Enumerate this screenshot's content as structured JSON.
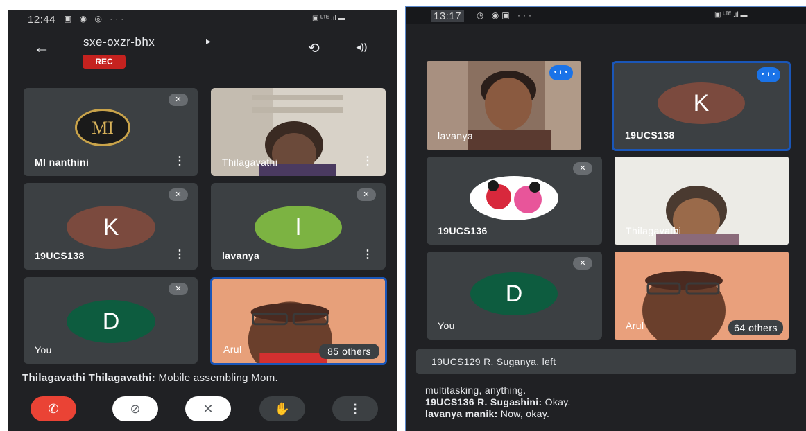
{
  "left": {
    "status": {
      "time": "12:44",
      "icons": "▣ ◉ ◎ ···",
      "right": "▣ ᴸᵀᴱ .ıl ▬"
    },
    "meeting": {
      "code": "sxe-oxzr-bhx",
      "code_arrow": "▸",
      "rec_label": "REC"
    },
    "back_icon": "←",
    "switch_camera_icon": "⟲",
    "speaker_icon": "◂))",
    "tiles": [
      {
        "name": "MI nanthini",
        "avatar_text": "MI",
        "menu": "⋮"
      },
      {
        "name": "Thilagavathi",
        "menu": "⋮"
      },
      {
        "name": "19UCS138",
        "avatar_text": "K",
        "avatar_color": "#7b4a3e",
        "menu": "⋮"
      },
      {
        "name": "lavanya",
        "avatar_text": "l",
        "avatar_color": "#7cb342",
        "menu": "⋮"
      },
      {
        "name": "You",
        "avatar_text": "D",
        "avatar_color": "#0d5c3f"
      },
      {
        "name": "Arul",
        "others": "85 others"
      }
    ],
    "caption": {
      "speaker": "Thilagavathi Thilagavathi:",
      "text": " Mobile assembling Mom."
    },
    "controls": {
      "end_call": "✆",
      "camera_off": "⊘",
      "mic_off": "✕",
      "raise_hand": "✋",
      "more": "⋮"
    },
    "colors": {
      "end_call": "#ea4335",
      "rec_badge": "#c5221f"
    }
  },
  "right": {
    "status": {
      "time": "13:17",
      "icons": "◷ ◉▣ ···",
      "right": "▣ ᴸᵀᴱ .ıl ▬"
    },
    "tiles": [
      {
        "name": "lavanya"
      },
      {
        "name": "19UCS138",
        "avatar_text": "K",
        "avatar_color": "#7b4a3e"
      },
      {
        "name": "19UCS136"
      },
      {
        "name": "Thilagavathi"
      },
      {
        "name": "You",
        "avatar_text": "D",
        "avatar_color": "#0d5c3f"
      },
      {
        "name": "Arul",
        "others": "64 others"
      }
    ],
    "notification": "19UCS129 R. Suganya. left",
    "chat": [
      {
        "speaker": "",
        "text": "multitasking, anything."
      },
      {
        "speaker": "19UCS136 R. Sugashini:",
        "text": " Okay."
      },
      {
        "speaker": "lavanya manik:",
        "text": " Now, okay."
      }
    ]
  }
}
